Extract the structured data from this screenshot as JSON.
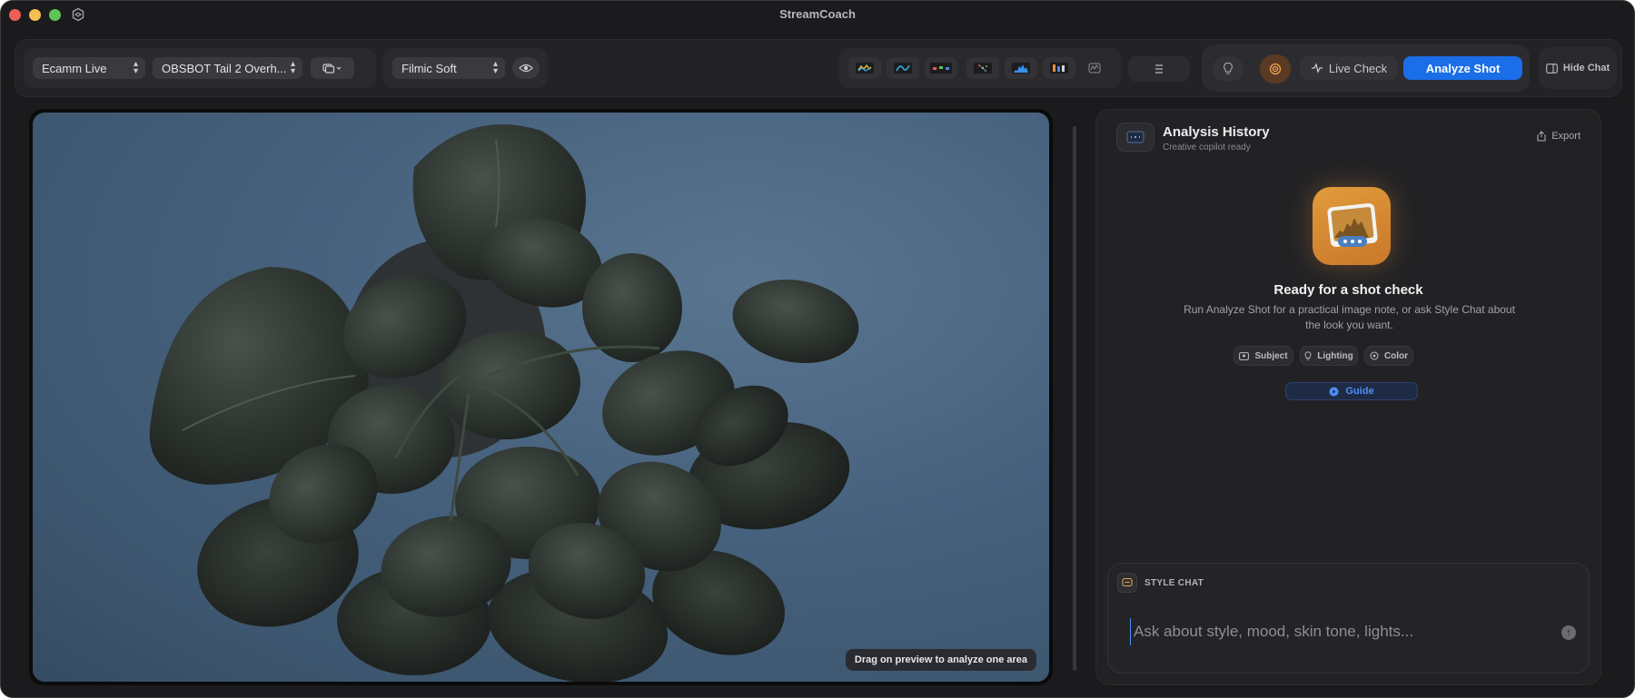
{
  "window": {
    "title": "StreamCoach"
  },
  "toolbar": {
    "source_select": "Ecamm Live",
    "camera_select": "OBSBOT Tail 2 Overh...",
    "look_select": "Filmic Soft",
    "scopes": [
      "waveform-scope-icon",
      "curve-scope-icon",
      "rgb-parade-icon",
      "vectorscope-icon",
      "histogram-icon",
      "false-color-icon",
      "zebra-icon"
    ],
    "live_check_label": "Live Check",
    "analyze_shot_label": "Analyze Shot",
    "hide_chat_label": "Hide Chat",
    "accent": "#1a6ee8"
  },
  "preview": {
    "hint": "Drag on preview to analyze one area"
  },
  "history": {
    "title": "Analysis History",
    "subtitle": "Creative copilot ready",
    "export_label": "Export",
    "hero_title": "Ready for a shot check",
    "hero_text": "Run Analyze Shot for a practical image note, or ask Style Chat about the look you want.",
    "chips": [
      {
        "label": "Subject",
        "icon": "subject-icon"
      },
      {
        "label": "Lighting",
        "icon": "lightbulb-icon"
      },
      {
        "label": "Color",
        "icon": "color-icon"
      }
    ],
    "guide_label": "Guide"
  },
  "chat": {
    "label": "STYLE CHAT",
    "placeholder": "Ask about style, mood, skin tone, lights..."
  }
}
